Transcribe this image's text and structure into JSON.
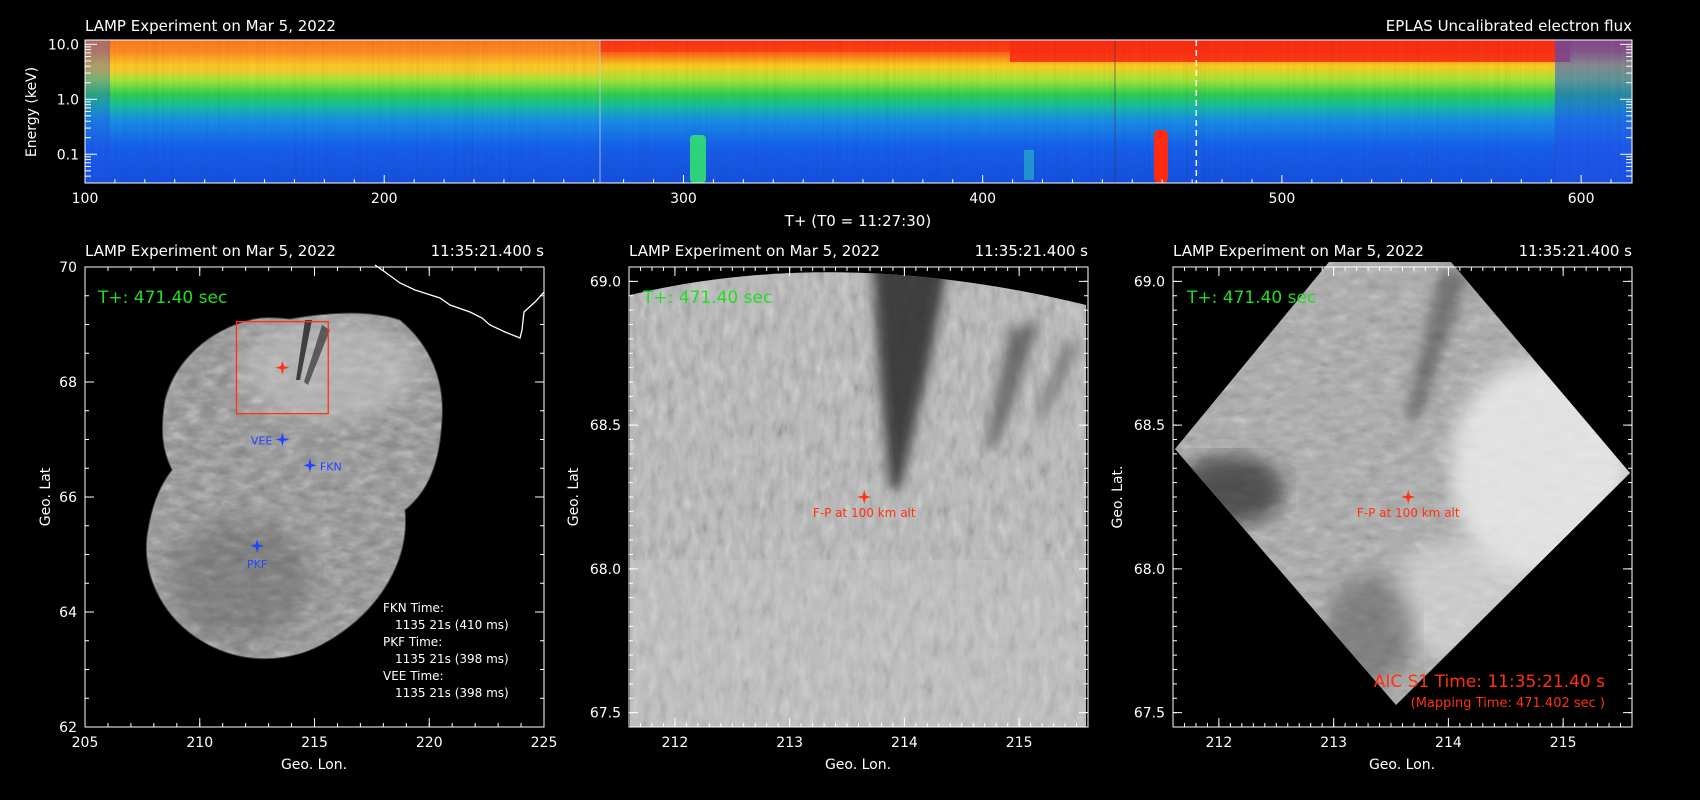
{
  "spectrogram": {
    "title_left": "LAMP Experiment on Mar 5, 2022",
    "title_right": "EPLAS Uncalibrated electron flux",
    "ylabel": "Energy (keV)",
    "xlabel": "T+ (T0 = 11:27:30)",
    "xticks": [
      "100",
      "200",
      "300",
      "400",
      "500",
      "600"
    ],
    "yticks": [
      "10.0",
      "1.0",
      "0.1"
    ]
  },
  "panels": [
    {
      "title_left": "LAMP Experiment on Mar 5, 2022",
      "title_right": "11:35:21.400 s",
      "tplus": "T+: 471.40 sec",
      "xlabel": "Geo. Lon.",
      "ylabel": "Geo. Lat",
      "xticks": [
        "205",
        "210",
        "215",
        "220",
        "225"
      ],
      "yticks": [
        "70",
        "68",
        "66",
        "64",
        "62"
      ],
      "stations": [
        "VEE",
        "FKN",
        "PKF"
      ],
      "times": [
        "FKN Time:",
        "1135 21s (410 ms)",
        "PKF Time:",
        "1135 21s (398 ms)",
        "VEE Time:",
        "1135 21s (398 ms)"
      ]
    },
    {
      "title_left": "LAMP Experiment on Mar 5, 2022",
      "title_right": "11:35:21.400 s",
      "tplus": "T+: 471.40 sec",
      "xlabel": "Geo. Lon.",
      "ylabel": "Geo. Lat",
      "xticks": [
        "212",
        "213",
        "214",
        "215"
      ],
      "yticks": [
        "69.0",
        "68.5",
        "68.0",
        "67.5"
      ],
      "fp_label": "F-P at 100 km alt"
    },
    {
      "title_left": "LAMP Experiment on Mar 5, 2022",
      "title_right": "11:35:21.400 s",
      "tplus": "T+: 471.40 sec",
      "xlabel": "Geo. Lon.",
      "ylabel": "Geo. Lat.",
      "xticks": [
        "212",
        "213",
        "214",
        "215"
      ],
      "yticks": [
        "69.0",
        "68.5",
        "68.0",
        "67.5"
      ],
      "fp_label": "F-P at 100 km alt",
      "aic_time": "AIC S1 Time: 11:35:21.40 s",
      "mapping_time": "(Mapping Time: 471.402 sec )"
    }
  ],
  "colors": {
    "background": "#000000",
    "axis": "#ffffff",
    "tplus": "#22dd22",
    "footpoint": "#ff3311",
    "station": "#2244ff",
    "spectro_low": "#1144ee",
    "spectro_mid": "#22cc44",
    "spectro_high": "#ff2a10"
  },
  "chart_data": [
    {
      "type": "heatmap",
      "title": "EPLAS Uncalibrated electron flux",
      "xlabel": "T+ (T0 = 11:27:30)",
      "ylabel": "Energy (keV)",
      "xlim": [
        100,
        617
      ],
      "ylim": [
        0.03,
        12
      ],
      "yscale": "log",
      "marker_time": 471.4,
      "bands": [
        {
          "energy_range_keV": [
            3,
            12
          ],
          "level": "high (red) after T+ 300, mixed yellow/red before"
        },
        {
          "energy_range_keV": [
            1,
            3
          ],
          "level": "mid (green/yellow)"
        },
        {
          "energy_range_keV": [
            0.03,
            1
          ],
          "level": "low (blue/cyan)"
        }
      ],
      "events": [
        {
          "t_range": [
            303,
            310
          ],
          "energy_keV": [
            0.04,
            0.2
          ],
          "level": "green"
        },
        {
          "t_range": [
            460,
            466
          ],
          "energy_keV": [
            0.04,
            0.3
          ],
          "level": "red"
        }
      ]
    },
    {
      "type": "scatter",
      "title": "LAMP Experiment on Mar 5, 2022",
      "xlabel": "Geo. Lon.",
      "ylabel": "Geo. Lat",
      "xlim": [
        205,
        225
      ],
      "ylim": [
        62,
        70
      ],
      "points": [
        {
          "name": "VEE",
          "x": 213.6,
          "y": 67.0
        },
        {
          "name": "FKN",
          "x": 214.8,
          "y": 66.55
        },
        {
          "name": "PKF",
          "x": 212.5,
          "y": 65.15
        },
        {
          "name": "F-P",
          "x": 213.6,
          "y": 68.25
        }
      ],
      "box": {
        "x": [
          211.6,
          215.6
        ],
        "y": [
          67.45,
          69.05
        ]
      }
    },
    {
      "type": "scatter",
      "title": "LAMP Experiment on Mar 5, 2022",
      "xlabel": "Geo. Lon.",
      "ylabel": "Geo. Lat",
      "xlim": [
        211.6,
        215.6
      ],
      "ylim": [
        67.45,
        69.05
      ],
      "points": [
        {
          "name": "F-P at 100 km alt",
          "x": 213.65,
          "y": 68.25
        }
      ]
    },
    {
      "type": "scatter",
      "title": "LAMP Experiment on Mar 5, 2022",
      "xlabel": "Geo. Lon.",
      "ylabel": "Geo. Lat.",
      "xlim": [
        211.6,
        215.6
      ],
      "ylim": [
        67.45,
        69.05
      ],
      "points": [
        {
          "name": "F-P at 100 km alt",
          "x": 213.65,
          "y": 68.25
        }
      ]
    }
  ]
}
